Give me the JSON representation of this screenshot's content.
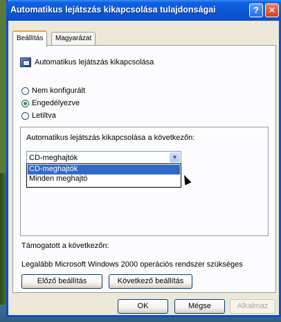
{
  "window": {
    "title": "Automatikus lejátszás kikapcsolása tulajdonságai",
    "help_label": "?",
    "close_label": "✕"
  },
  "tabs": [
    {
      "label": "Beállítás",
      "active": true
    },
    {
      "label": "Magyarázat",
      "active": false
    }
  ],
  "policy": {
    "name": "Automatikus lejátszás kikapcsolása"
  },
  "radios": [
    {
      "label": "Nem konfigurált",
      "checked": false
    },
    {
      "label": "Engedélyezve",
      "checked": true
    },
    {
      "label": "Letiltva",
      "checked": false
    }
  ],
  "options": {
    "label": "Automatikus lejátszás kikapcsolása a következőn:",
    "selected": "CD-meghajtók",
    "dropdown_items": [
      "CD-meghajtók",
      "Minden meghajtó"
    ]
  },
  "supported": {
    "label": "Támogatott a következőn:",
    "text": "Legalább Microsoft Windows 2000 operációs rendszer szükséges"
  },
  "nav_buttons": {
    "prev": "Előző beállítás",
    "next": "Következő beállítás"
  },
  "footer": {
    "ok": "OK",
    "cancel": "Mégse",
    "apply": "Alkalmaz"
  },
  "colors": {
    "titlebar": "#0a55d4",
    "selection": "#316ac5",
    "radio_dot": "#21a121"
  }
}
